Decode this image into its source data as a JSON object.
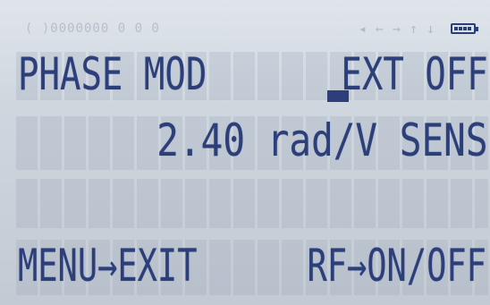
{
  "status_bar": {
    "left_text": "( )0000000 0 0 0",
    "arrows": [
      "◂",
      "←",
      "→",
      "↑",
      "↓"
    ],
    "battery": {
      "icon": "battery-icon",
      "level": 1.0
    }
  },
  "display": {
    "row1": {
      "left": "PHASE MOD",
      "right": "EXT OFF"
    },
    "row2": {
      "text": "2.40 rad/V SENS"
    },
    "row3": {
      "text": ""
    },
    "row4": {
      "left": "MENU→EXIT",
      "right": "RF→ON/OFF"
    }
  },
  "colors": {
    "lcd_background": "#d4dbe2",
    "segment_on": "#2c3f7a"
  }
}
